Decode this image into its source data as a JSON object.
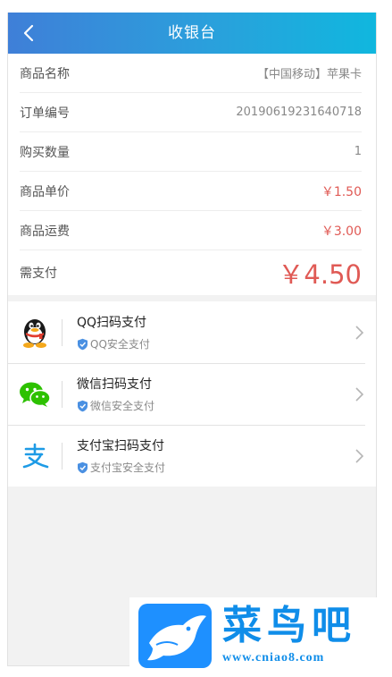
{
  "header": {
    "title": "收银台",
    "back_icon": "chevron-left-icon"
  },
  "order": {
    "rows": [
      {
        "label": "商品名称",
        "value": "【中国移动】苹果卡"
      },
      {
        "label": "订单编号",
        "value": "20190619231640718"
      },
      {
        "label": "购买数量",
        "value": "1"
      },
      {
        "label": "商品单价",
        "value": "￥1.50"
      },
      {
        "label": "商品运费",
        "value": "￥3.00"
      }
    ],
    "total_label": "需支付",
    "total_value": "￥4.50"
  },
  "payment_methods": [
    {
      "name": "QQ扫码支付",
      "subtitle": "QQ安全支付",
      "icon": "qq-penguin-icon"
    },
    {
      "name": "微信扫码支付",
      "subtitle": "微信安全支付",
      "icon": "wechat-icon"
    },
    {
      "name": "支付宝扫码支付",
      "subtitle": "支付宝安全支付",
      "icon": "alipay-icon"
    }
  ],
  "watermark": {
    "name": "菜鸟吧",
    "url": "www.cniao8.com",
    "logo_icon": "bird-logo-icon"
  },
  "colors": {
    "header_start": "#3f7fd8",
    "header_end": "#10b7de",
    "price": "#e05a55",
    "shield": "#4a90e2",
    "watermark_blue": "#0f8de9"
  }
}
